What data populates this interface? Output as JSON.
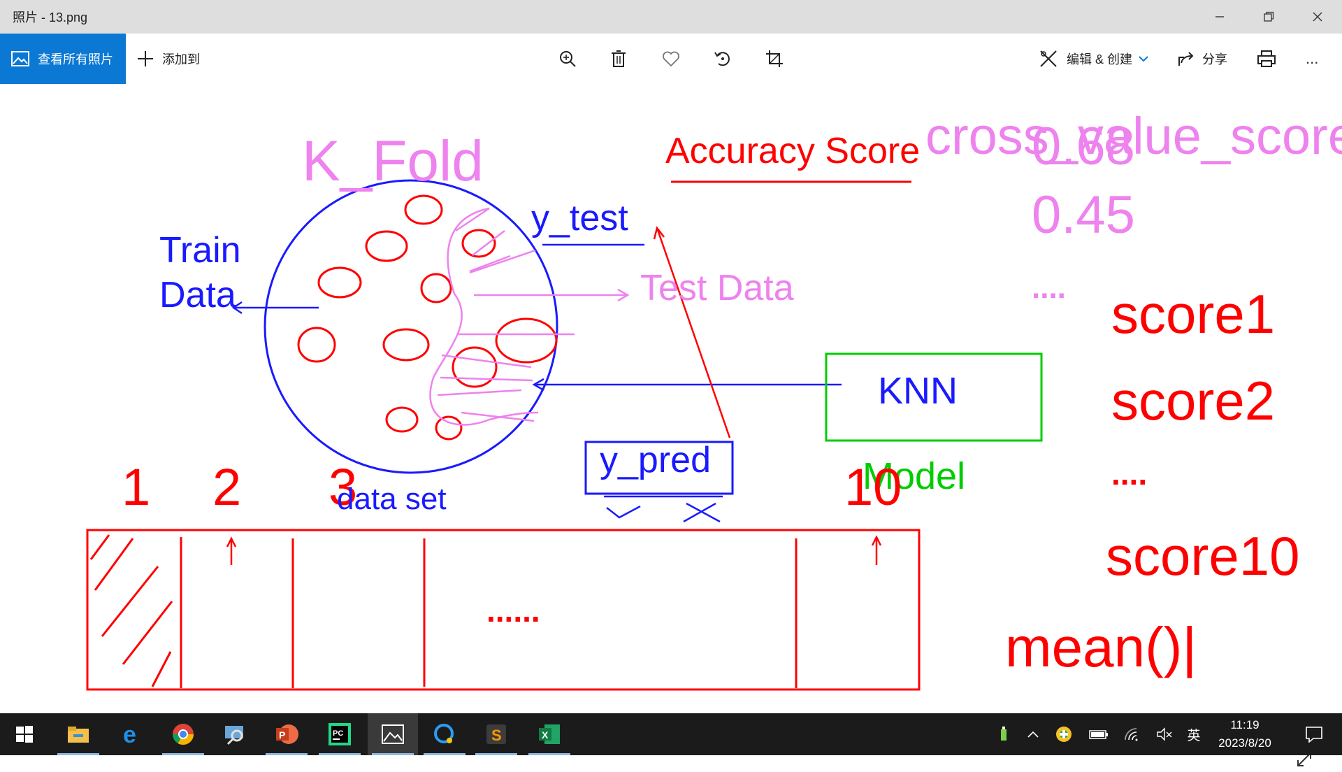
{
  "window": {
    "title": "照片 - 13.png"
  },
  "toolbar": {
    "view_all_label": "查看所有照片",
    "add_to_label": "添加到",
    "edit_create_label": "编辑 & 创建",
    "share_label": "分享",
    "more_label": "..."
  },
  "canvas": {
    "cross_value_score": "cross_value_score",
    "k_fold": "K_Fold",
    "accuracy_score": "Accuracy Score",
    "score_a": "0.68",
    "score_b": "0.45",
    "dots_right": "....",
    "y_test": "y_test",
    "train": "Train",
    "data": "Data",
    "test_data": "Test Data",
    "knn": "KNN",
    "model": "Model",
    "y_pred": "y_pred",
    "score1": "score1",
    "score2": "score2",
    "dots_scores": "....",
    "score10": "score10",
    "mean": "mean()|",
    "fold_1": "1",
    "fold_2": "2",
    "fold_3": "3",
    "fold_10": "10",
    "data_set": "data set",
    "dots_middle": "......"
  },
  "taskbar": {
    "apps": [
      "file-explorer",
      "edge",
      "chrome",
      "search-app",
      "powerpoint",
      "pycharm",
      "photos",
      "qq-browser",
      "sublime-text",
      "excel"
    ],
    "time": "11:19",
    "date": "2023/8/20",
    "ime": "英"
  },
  "colors": {
    "pink": "#ee82ee",
    "red": "#ff0000",
    "blue": "#1a1aff",
    "green": "#00cc00",
    "accent": "#0b78d4"
  }
}
